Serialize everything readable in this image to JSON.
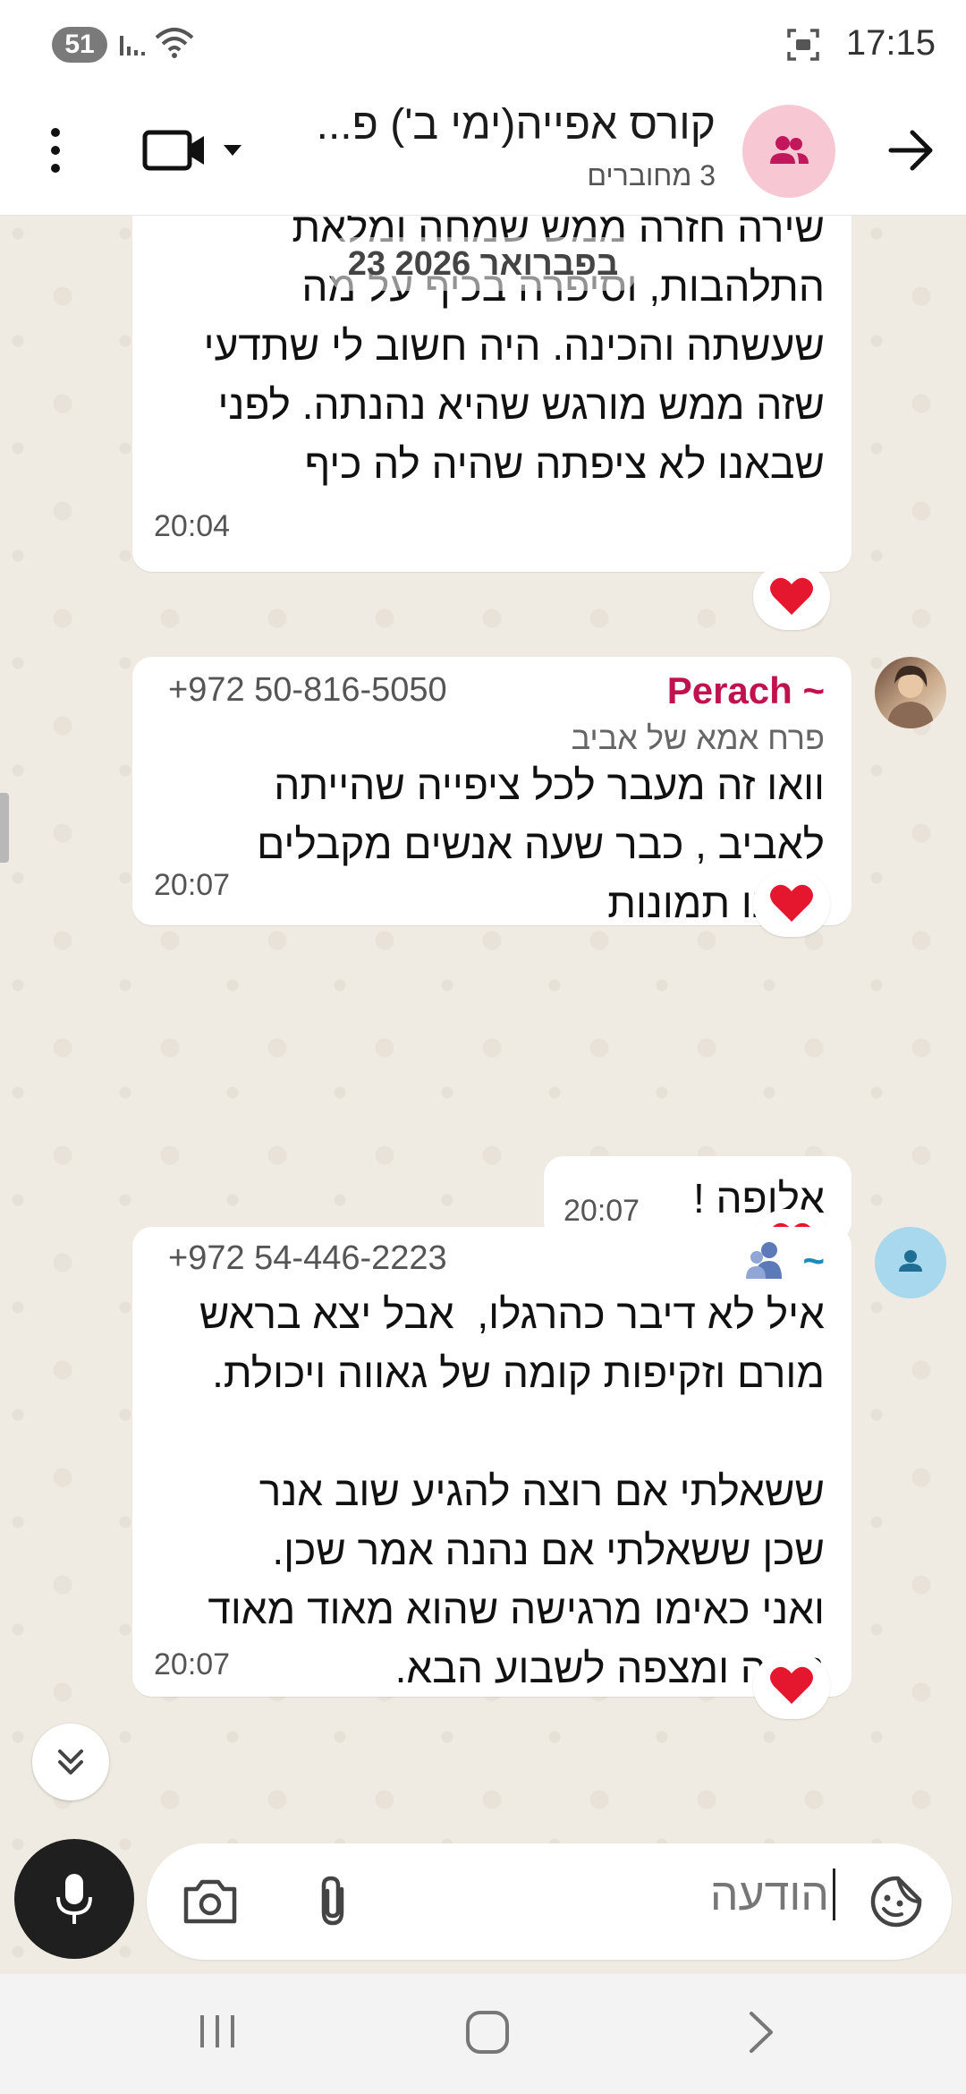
{
  "status_bar": {
    "notification_count": "51",
    "time": "17:15"
  },
  "header": {
    "title": "קורס אפייה(ימי ב') פ...",
    "subtitle": "3 מחוברים"
  },
  "chat": {
    "date_chip": "23 בפברואר 2026",
    "messages": [
      {
        "text": "שירה חזרה ממש שמחה ומלאת\nהתלהבות, וסיפרה בכיף על מה\nשעשתה והכינה. היה חשוב לי שתדעי\nשזה ממש מורגש שהיא נהנתה. לפני\nשבאנו לא ציפתה שהיה לה כיף",
        "time": "20:04",
        "reaction": "❤"
      },
      {
        "sender_name": "~ Perach",
        "sender_phone": "+972 50-816-5050",
        "sender_push_name": "פרח אמא של אביב",
        "text": "וואו זה מעבר לכל ציפייה שהייתה\nלאביב , כבר שעה אנשים מקבלים\nממנו תמונות",
        "time": "20:07",
        "reaction": "❤"
      },
      {
        "text": "אלופה !",
        "time": "20:07",
        "reaction": "❤"
      },
      {
        "sender_name": "~",
        "sender_phone": "+972 54-446-2223",
        "text": "איל לא דיבר כהרגלו,  אבל יצא בראש\nמורם וזקיפות קומה של גאווה ויכולת.\n\nששאלתי אם רוצה להגיע שוב אנר\nשכן ששאלתי אם נהנה אמר שכן.\nואני כאימו מרגישה שהוא מאוד מאוד\nנהנה ומצפה לשבוע הבא.",
        "time": "20:07",
        "reaction": "❤"
      }
    ]
  },
  "input_bar": {
    "placeholder": "הודעה"
  },
  "colors": {
    "header_bg": "#ffffff",
    "chat_bg": "#efeae2",
    "sender_color": "#c0134d",
    "heart": "#e5172f",
    "group_avatar_bg": "#f7c8d4"
  }
}
